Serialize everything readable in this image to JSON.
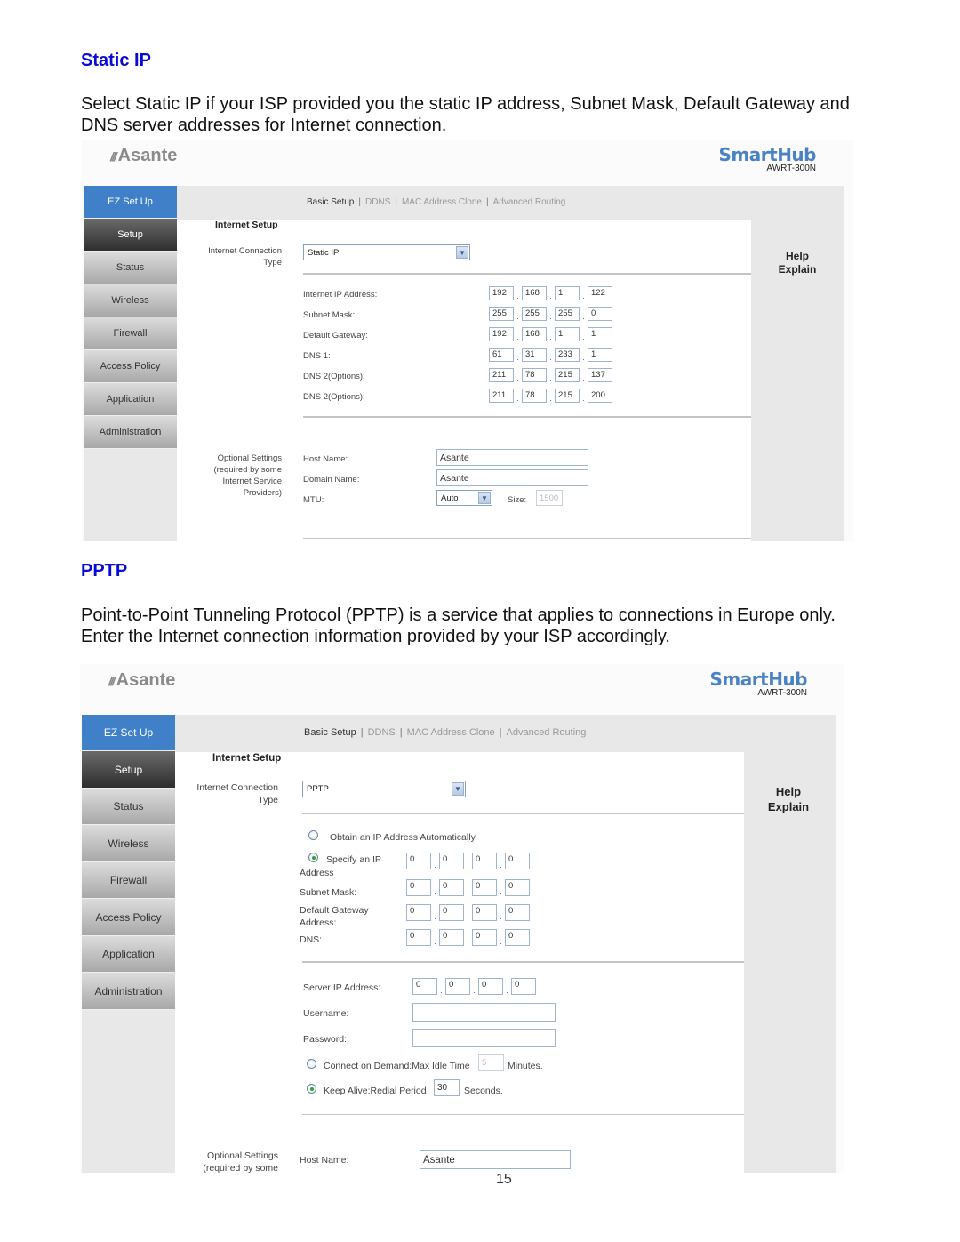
{
  "sections": {
    "static_ip": {
      "heading": "Static IP",
      "paragraph": "Select Static IP if your ISP provided you the static IP address, Subnet Mask, Default Gateway and DNS server addresses for Internet connection."
    },
    "pptp": {
      "heading": "PPTP",
      "paragraph": "Point-to-Point Tunneling Protocol (PPTP) is a service that applies to connections in Europe only. Enter the Internet connection information provided by your ISP accordingly."
    }
  },
  "brand": {
    "logo_mark": "///",
    "logo_text": "Asante",
    "product": "SmartHub",
    "model": "AWRT-300N"
  },
  "sidebar": {
    "items": [
      "EZ Set Up",
      "Setup",
      "Status",
      "Wireless",
      "Firewall",
      "Access Policy",
      "Application",
      "Administration"
    ],
    "active": "Setup"
  },
  "subnav": {
    "items": [
      "Basic Setup",
      "DDNS",
      "MAC Address Clone",
      "Advanced Routing"
    ],
    "separator": "|",
    "current": "Basic Setup"
  },
  "help": {
    "line1": "Help",
    "line2": "Explain"
  },
  "panel1": {
    "section_title": "Internet Setup",
    "connection_type_label_1": "Internet Connection",
    "connection_type_label_2": "Type",
    "connection_type_value": "Static IP",
    "fields": [
      {
        "label": "Internet IP Address:",
        "octets": [
          "192",
          "168",
          "1",
          "122"
        ]
      },
      {
        "label": "Subnet Mask:",
        "octets": [
          "255",
          "255",
          "255",
          "0"
        ]
      },
      {
        "label": "Default Gateway:",
        "octets": [
          "192",
          "168",
          "1",
          "1"
        ]
      },
      {
        "label": "DNS 1:",
        "octets": [
          "61",
          "31",
          "233",
          "1"
        ]
      },
      {
        "label": "DNS 2(Options):",
        "octets": [
          "211",
          "78",
          "215",
          "137"
        ]
      },
      {
        "label": "DNS 2(Options):",
        "octets": [
          "211",
          "78",
          "215",
          "200"
        ]
      }
    ],
    "optional_label": [
      "Optional Settings",
      "(required by some",
      "Internet Service",
      "Providers)"
    ],
    "host_name_label": "Host Name:",
    "host_name_value": "Asante",
    "domain_name_label": "Domain Name:",
    "domain_name_value": "Asante",
    "mtu_label": "MTU:",
    "mtu_value": "Auto",
    "size_label": "Size:",
    "size_value": "1500"
  },
  "panel2": {
    "section_title": "Internet Setup",
    "connection_type_label_1": "Internet Connection",
    "connection_type_label_2": "Type",
    "connection_type_value": "PPTP",
    "obtain_auto_label": "Obtain an IP Address Automatically.",
    "obtain_auto_selected": false,
    "specify_label_1": "Specify an IP",
    "specify_label_2": "Address",
    "specify_selected": true,
    "specify_octets": [
      "0",
      "0",
      "0",
      "0"
    ],
    "subnet_label": "Subnet Mask:",
    "subnet_octets": [
      "0",
      "0",
      "0",
      "0"
    ],
    "gateway_label_1": "Default Gateway",
    "gateway_label_2": "Address:",
    "gateway_octets": [
      "0",
      "0",
      "0",
      "0"
    ],
    "dns_label": "DNS:",
    "dns_octets": [
      "0",
      "0",
      "0",
      "0"
    ],
    "server_ip_label": "Server IP Address:",
    "server_ip_octets": [
      "0",
      "0",
      "0",
      "0"
    ],
    "username_label": "Username:",
    "username_value": "",
    "password_label": "Password:",
    "password_value": "",
    "connect_on_demand_label": "Connect on Demand:Max Idle Time",
    "connect_on_demand_selected": false,
    "max_idle_value": "5",
    "minutes_label": "Minutes.",
    "keep_alive_label": "Keep Alive:Redial Period",
    "keep_alive_selected": true,
    "redial_value": "30",
    "seconds_label": "Seconds.",
    "optional_label": [
      "Optional Settings",
      "(required by some"
    ],
    "host_name_label": "Host Name:",
    "host_name_value": "Asante"
  },
  "page_number": "15"
}
